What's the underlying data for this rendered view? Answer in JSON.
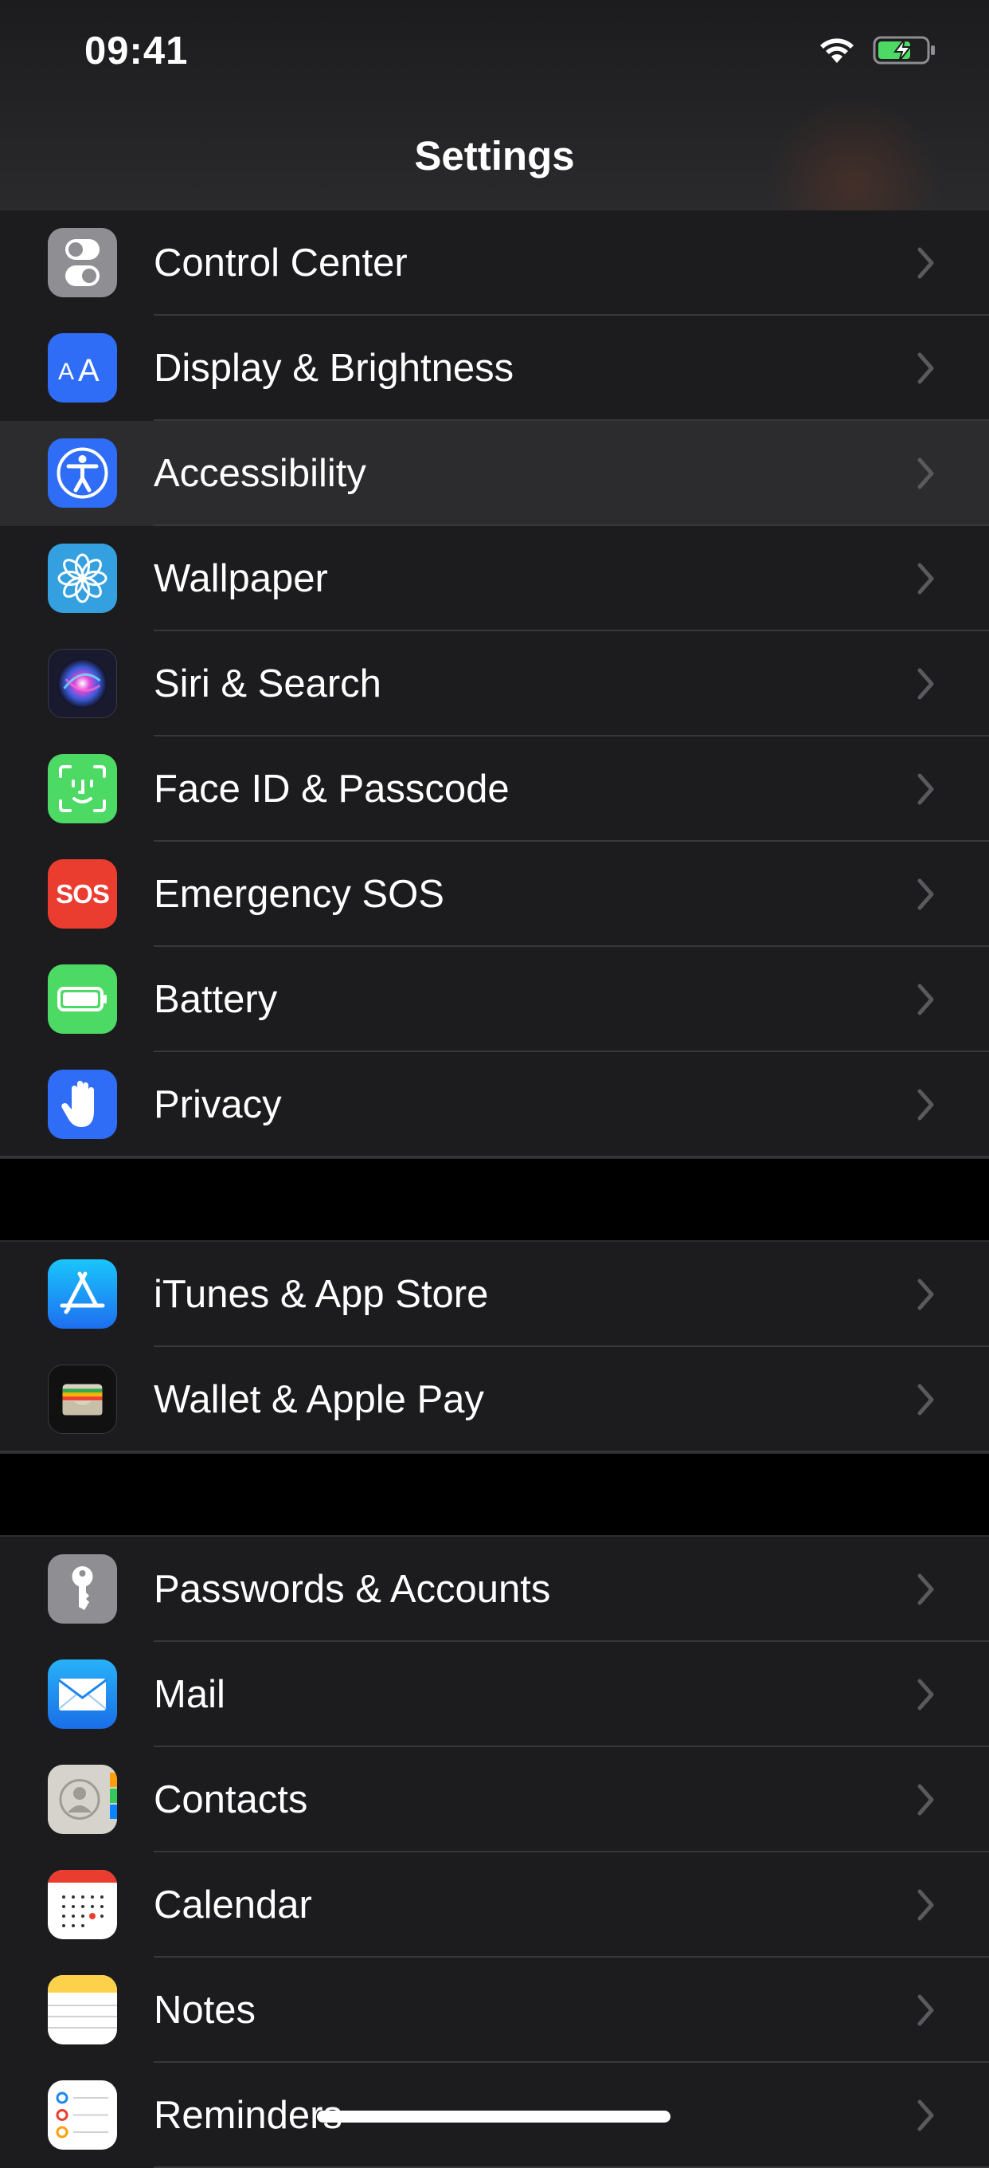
{
  "status_bar": {
    "time": "09:41"
  },
  "nav": {
    "title": "Settings"
  },
  "groups": [
    {
      "items": [
        {
          "label": "Control Center",
          "icon": "toggle-switches-icon",
          "color": "#8e8e93"
        },
        {
          "label": "Display & Brightness",
          "icon": "text-size-icon",
          "color": "#2f6df6"
        },
        {
          "label": "Accessibility",
          "icon": "accessibility-person-icon",
          "color": "#2f6df6",
          "selected": true
        },
        {
          "label": "Wallpaper",
          "icon": "flower-icon",
          "color": "#34a0e0"
        },
        {
          "label": "Siri & Search",
          "icon": "siri-orb-icon",
          "color": "#1a1a2e"
        },
        {
          "label": "Face ID & Passcode",
          "icon": "face-id-icon",
          "color": "#4cd964"
        },
        {
          "label": "Emergency SOS",
          "icon": "sos-icon",
          "color": "#eb3c30",
          "icon_text": "SOS"
        },
        {
          "label": "Battery",
          "icon": "battery-icon",
          "color": "#4cd964"
        },
        {
          "label": "Privacy",
          "icon": "hand-icon",
          "color": "#2f6df6"
        }
      ]
    },
    {
      "items": [
        {
          "label": "iTunes & App Store",
          "icon": "app-store-icon",
          "color": "#1e8ef5"
        },
        {
          "label": "Wallet & Apple Pay",
          "icon": "wallet-icon",
          "color": "#111111"
        }
      ]
    },
    {
      "items": [
        {
          "label": "Passwords & Accounts",
          "icon": "key-icon",
          "color": "#8e8e93"
        },
        {
          "label": "Mail",
          "icon": "mail-envelope-icon",
          "color": "#1f86f0"
        },
        {
          "label": "Contacts",
          "icon": "contacts-icon",
          "color": "#d1d1d6"
        },
        {
          "label": "Calendar",
          "icon": "calendar-icon",
          "color": "#ffffff"
        },
        {
          "label": "Notes",
          "icon": "notes-icon",
          "color": "#ffffff"
        },
        {
          "label": "Reminders",
          "icon": "reminders-icon",
          "color": "#ffffff"
        }
      ]
    }
  ]
}
